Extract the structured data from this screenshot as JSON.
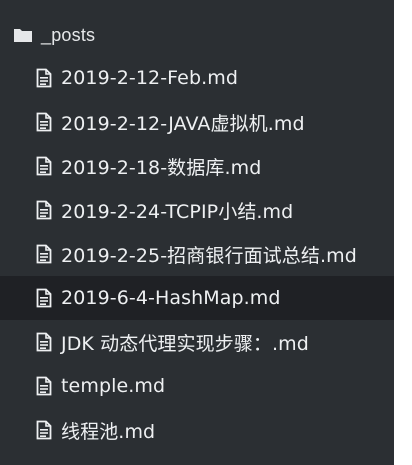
{
  "sidebar": {
    "folder": {
      "icon": "folder-icon",
      "label": "_posts"
    },
    "files": [
      {
        "icon": "file-icon",
        "label": "2019-2-12-Feb.md",
        "active": false
      },
      {
        "icon": "file-icon",
        "label": "2019-2-12-JAVA虚拟机.md",
        "active": false
      },
      {
        "icon": "file-icon",
        "label": "2019-2-18-数据库.md",
        "active": false
      },
      {
        "icon": "file-icon",
        "label": "2019-2-24-TCPIP小结.md",
        "active": false
      },
      {
        "icon": "file-icon",
        "label": "2019-2-25-招商银行面试总结.md",
        "active": false
      },
      {
        "icon": "file-icon",
        "label": "2019-6-4-HashMap.md",
        "active": true
      },
      {
        "icon": "file-icon",
        "label": "JDK 动态代理实现步骤：.md",
        "active": false
      },
      {
        "icon": "file-icon",
        "label": "temple.md",
        "active": false
      },
      {
        "icon": "file-icon",
        "label": "线程池.md",
        "active": false
      }
    ]
  },
  "colors": {
    "background": "#2b2f33",
    "active_row": "#1f2125",
    "text": "#eef0f2"
  }
}
